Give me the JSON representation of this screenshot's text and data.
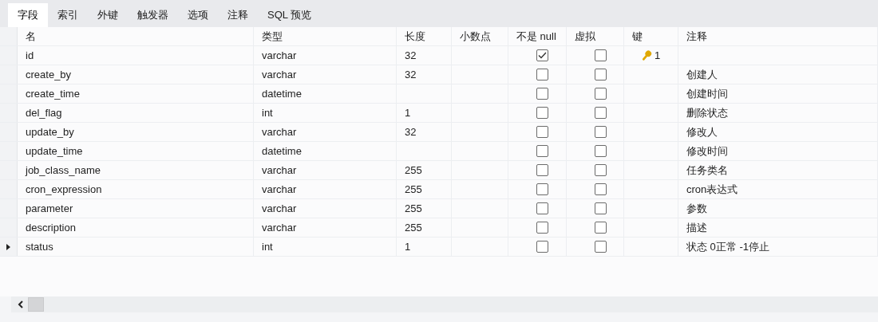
{
  "tabs": [
    {
      "label": "字段",
      "selected": true
    },
    {
      "label": "索引",
      "selected": false
    },
    {
      "label": "外键",
      "selected": false
    },
    {
      "label": "触发器",
      "selected": false
    },
    {
      "label": "选项",
      "selected": false
    },
    {
      "label": "注释",
      "selected": false
    },
    {
      "label": "SQL 预览",
      "selected": false
    }
  ],
  "table": {
    "columns": [
      "名",
      "类型",
      "长度",
      "小数点",
      "不是 null",
      "虚拟",
      "键",
      "注释"
    ],
    "rows": [
      {
        "name": "id",
        "type": "varchar",
        "length": "32",
        "not_null": true,
        "virtual": false,
        "key": "1",
        "current": false
      },
      {
        "name": "create_by",
        "type": "varchar",
        "length": "32",
        "not_null": false,
        "virtual": false,
        "comment": "创建人",
        "current": false
      },
      {
        "name": "create_time",
        "type": "datetime",
        "not_null": false,
        "virtual": false,
        "comment": "创建时间",
        "current": false
      },
      {
        "name": "del_flag",
        "type": "int",
        "length": "1",
        "not_null": false,
        "virtual": false,
        "comment": "删除状态",
        "current": false
      },
      {
        "name": "update_by",
        "type": "varchar",
        "length": "32",
        "not_null": false,
        "virtual": false,
        "comment": "修改人",
        "current": false
      },
      {
        "name": "update_time",
        "type": "datetime",
        "not_null": false,
        "virtual": false,
        "comment": "修改时间",
        "current": false
      },
      {
        "name": "job_class_name",
        "type": "varchar",
        "length": "255",
        "not_null": false,
        "virtual": false,
        "comment": "任务类名",
        "current": false
      },
      {
        "name": "cron_expression",
        "type": "varchar",
        "length": "255",
        "not_null": false,
        "virtual": false,
        "comment": "cron表达式",
        "current": false
      },
      {
        "name": "parameter",
        "type": "varchar",
        "length": "255",
        "not_null": false,
        "virtual": false,
        "comment": "参数",
        "current": false
      },
      {
        "name": "description",
        "type": "varchar",
        "length": "255",
        "not_null": false,
        "virtual": false,
        "comment": "描述",
        "current": false
      },
      {
        "name": "status",
        "type": "int",
        "length": "1",
        "not_null": false,
        "virtual": false,
        "comment": "状态 0正常 -1停止",
        "current": true
      }
    ]
  }
}
